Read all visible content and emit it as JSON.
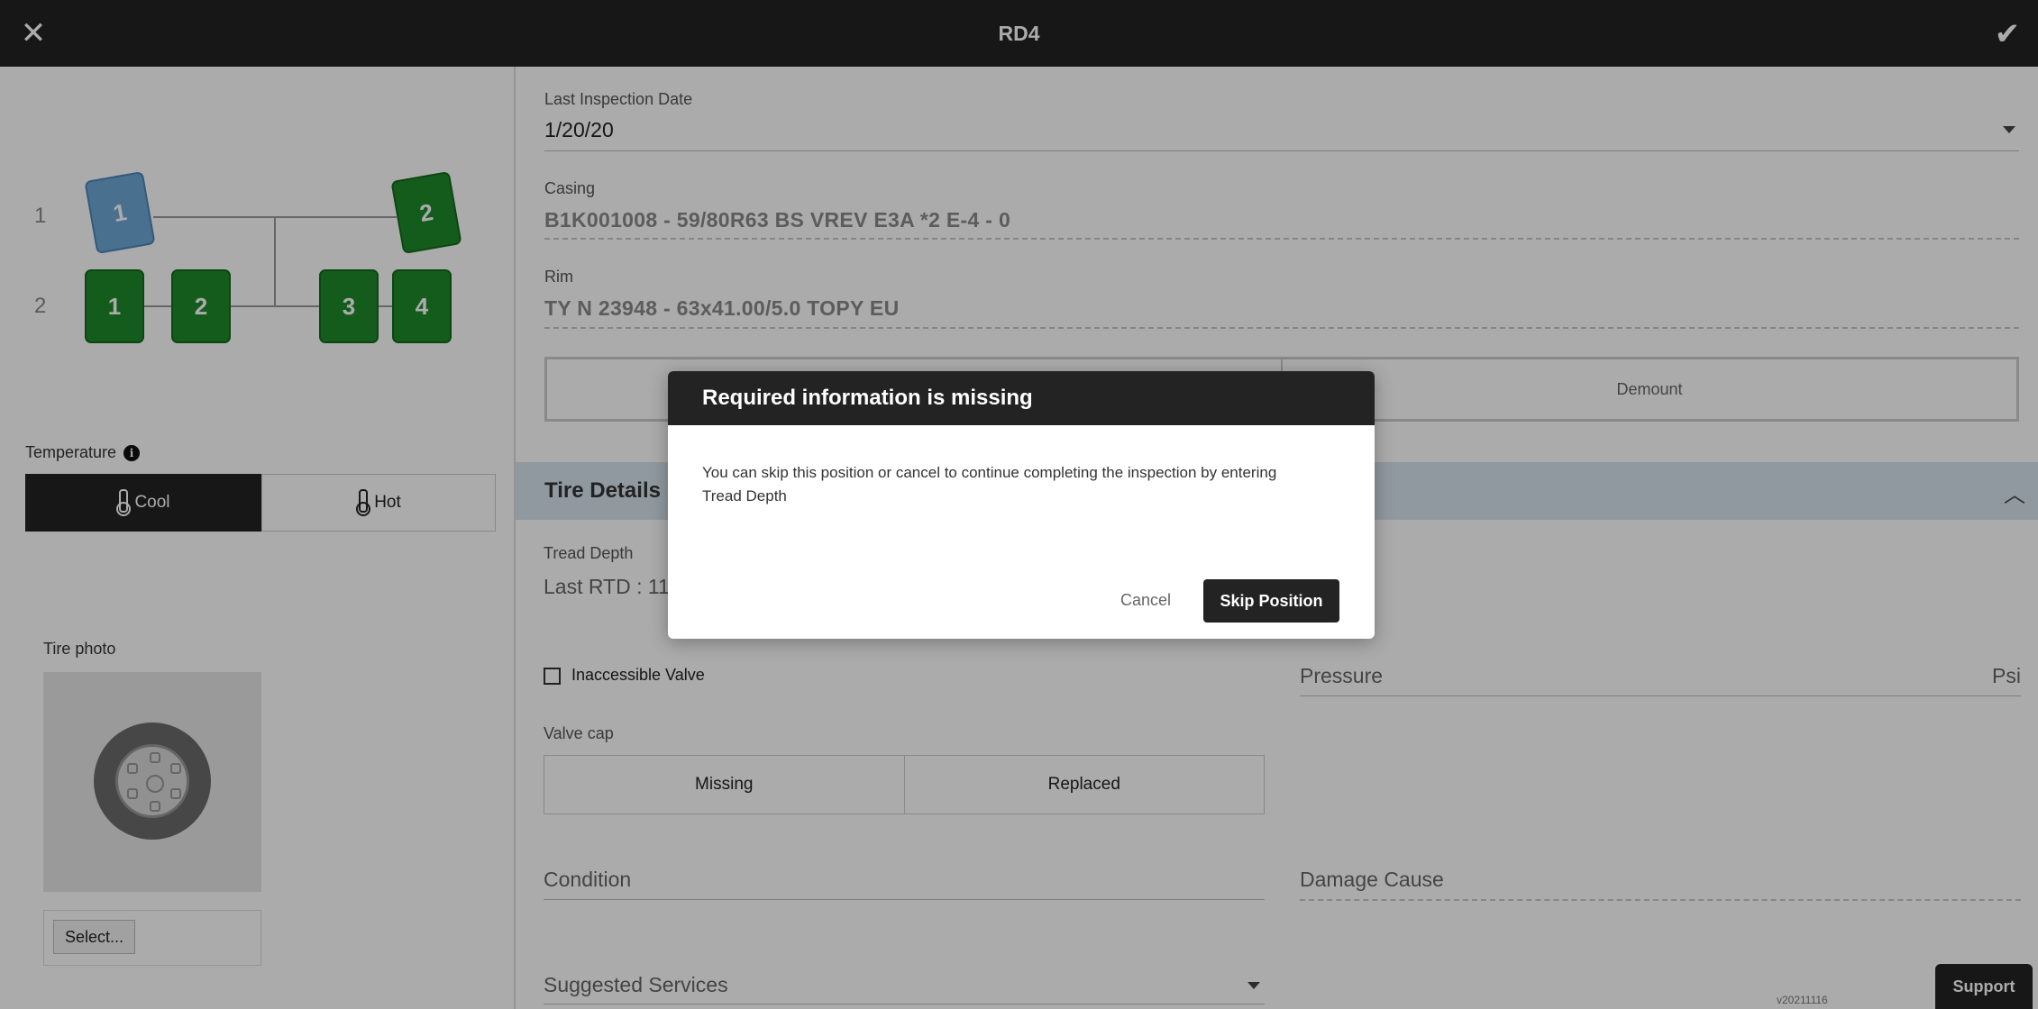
{
  "header": {
    "title": "RD4",
    "close_icon": "close-icon",
    "confirm_icon": "check-icon"
  },
  "axles": {
    "axle_1_label": "1",
    "axle_2_label": "2",
    "axle_1_tires": [
      "1",
      "2"
    ],
    "axle_2_tires": [
      "1",
      "2",
      "3",
      "4"
    ],
    "selected_tire": "axle 1 position 1",
    "tire_color": "#1f8a2a",
    "selected_color": "#6fa7d6"
  },
  "temperature": {
    "label": "Temperature",
    "options": [
      "Cool",
      "Hot"
    ],
    "selected": "Cool"
  },
  "tire_photo": {
    "label": "Tire photo",
    "select_label": "Select..."
  },
  "fields": {
    "last_inspection_label": "Last Inspection Date",
    "last_inspection_value": "1/20/20",
    "casing_label": "Casing",
    "casing_value": "B1K001008 - 59/80R63 BS VREV E3A *2 E-4 - 0",
    "rim_label": "Rim",
    "rim_value": "TY N 23948 - 63x41.00/5.0 TOPY EU",
    "demount_label": "Demount"
  },
  "tire_details": {
    "section_title": "Tire Details",
    "tread_depth_label": "Tread Depth",
    "last_rtd_partial": "Last RTD : 11",
    "inaccessible_valve_label": "Inaccessible Valve",
    "pressure_label": "Pressure",
    "pressure_unit": "Psi",
    "valve_cap_label": "Valve cap",
    "valve_cap_options": [
      "Missing",
      "Replaced"
    ],
    "condition_label": "Condition",
    "damage_cause_label": "Damage Cause",
    "suggested_services_label": "Suggested Services"
  },
  "footer": {
    "version": "v20211116",
    "support_label": "Support"
  },
  "modal": {
    "title": "Required information is missing",
    "message_line1": "You can skip this position or cancel to continue completing the inspection by entering",
    "message_line2": "Tread Depth",
    "cancel_label": "Cancel",
    "skip_label": "Skip Position"
  }
}
